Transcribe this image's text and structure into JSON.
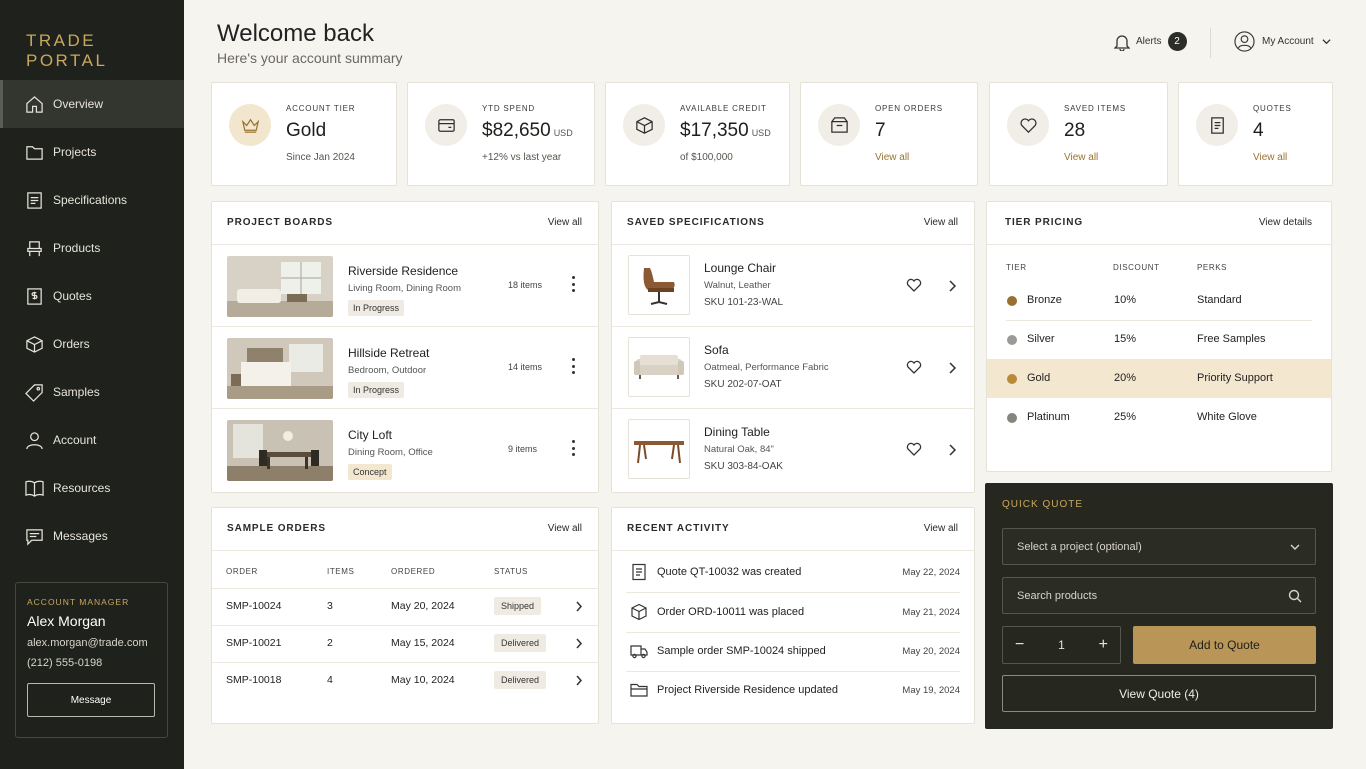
{
  "brand": "TRADE PORTAL",
  "nav": [
    {
      "label": "Overview",
      "icon": "home-icon",
      "active": true
    },
    {
      "label": "Projects",
      "icon": "folder-icon"
    },
    {
      "label": "Specifications",
      "icon": "document-icon"
    },
    {
      "label": "Products",
      "icon": "chair-icon"
    },
    {
      "label": "Quotes",
      "icon": "dollar-document-icon"
    },
    {
      "label": "Orders",
      "icon": "box-icon"
    },
    {
      "label": "Samples",
      "icon": "tag-icon"
    },
    {
      "label": "Account",
      "icon": "user-icon"
    },
    {
      "label": "Resources",
      "icon": "book-icon"
    },
    {
      "label": "Messages",
      "icon": "message-icon"
    }
  ],
  "manager": {
    "label": "ACCOUNT MANAGER",
    "name": "Alex Morgan",
    "email": "alex.morgan@trade.com",
    "phone": "(212) 555-0198",
    "button": "Message"
  },
  "header": {
    "title": "Welcome back",
    "subtitle": "Here's your account summary",
    "alerts_label": "Alerts",
    "alerts_count": "2",
    "account_label": "My Account"
  },
  "stats": [
    {
      "label": "ACCOUNT TIER",
      "value": "Gold",
      "unit": "",
      "sub": "Since Jan 2024",
      "icon": "crown-icon"
    },
    {
      "label": "YTD SPEND",
      "value": "$82,650",
      "unit": "USD",
      "sub": "+12% vs last year",
      "icon": "card-icon"
    },
    {
      "label": "AVAILABLE CREDIT",
      "value": "$17,350",
      "unit": "USD",
      "sub": "of $100,000",
      "icon": "box-icon"
    },
    {
      "label": "OPEN ORDERS",
      "value": "7",
      "unit": "",
      "sub": "View all",
      "icon": "box-icon"
    },
    {
      "label": "SAVED ITEMS",
      "value": "28",
      "unit": "",
      "sub": "View all",
      "icon": "heart-icon"
    },
    {
      "label": "QUOTES",
      "value": "4",
      "unit": "",
      "sub": "View all",
      "icon": "document-icon"
    }
  ],
  "boards": {
    "title": "PROJECT BOARDS",
    "link": "View all",
    "items": [
      {
        "name": "Riverside Residence",
        "rooms": "Living Room, Dining Room",
        "status": "In Progress",
        "count": "18 items"
      },
      {
        "name": "Hillside Retreat",
        "rooms": "Bedroom, Outdoor",
        "status": "In Progress",
        "count": "14 items"
      },
      {
        "name": "City Loft",
        "rooms": "Dining Room, Office",
        "status": "Concept",
        "count": "9 items"
      }
    ]
  },
  "specs": {
    "title": "SAVED SPECIFICATIONS",
    "link": "View all",
    "items": [
      {
        "name": "Lounge Chair",
        "material": "Walnut, Leather",
        "sku": "SKU 101-23-WAL"
      },
      {
        "name": "Sofa",
        "material": "Oatmeal, Performance Fabric",
        "sku": "SKU 202-07-OAT"
      },
      {
        "name": "Dining Table",
        "material": "Natural Oak, 84\"",
        "sku": "SKU 303-84-OAK"
      }
    ]
  },
  "tiers": {
    "title": "TIER PRICING",
    "link": "View details",
    "headers": [
      "TIER",
      "DISCOUNT",
      "PERKS"
    ],
    "rows": [
      {
        "name": "Bronze",
        "discount": "10%",
        "perks": "Standard",
        "color": "#9a6f32"
      },
      {
        "name": "Silver",
        "discount": "15%",
        "perks": "Free Samples",
        "color": "#9a9a96"
      },
      {
        "name": "Gold",
        "discount": "20%",
        "perks": "Priority Support",
        "color": "#b98a37"
      },
      {
        "name": "Platinum",
        "discount": "25%",
        "perks": "White Glove",
        "color": "#85847f"
      }
    ]
  },
  "orders": {
    "title": "SAMPLE ORDERS",
    "link": "View all",
    "headers": [
      "ORDER",
      "ITEMS",
      "ORDERED",
      "STATUS"
    ],
    "rows": [
      {
        "id": "SMP-10024",
        "items": "3",
        "date": "May 20, 2024",
        "status": "Shipped"
      },
      {
        "id": "SMP-10021",
        "items": "2",
        "date": "May 15, 2024",
        "status": "Delivered"
      },
      {
        "id": "SMP-10018",
        "items": "4",
        "date": "May 10, 2024",
        "status": "Delivered"
      }
    ]
  },
  "activity": {
    "title": "RECENT ACTIVITY",
    "link": "View all",
    "items": [
      {
        "text": "Quote QT-10032 was created",
        "date": "May 22, 2024",
        "icon": "document-icon"
      },
      {
        "text": "Order ORD-10011 was placed",
        "date": "May 21, 2024",
        "icon": "box-icon"
      },
      {
        "text": "Sample order SMP-10024 shipped",
        "date": "May 20, 2024",
        "icon": "truck-icon"
      },
      {
        "text": "Project Riverside Residence updated",
        "date": "May 19, 2024",
        "icon": "folder-icon"
      }
    ]
  },
  "quick_quote": {
    "title": "QUICK QUOTE",
    "project_placeholder": "Select a project (optional)",
    "search_placeholder": "Search products",
    "quantity": "1",
    "add_label": "Add to Quote",
    "view_label": "View Quote (4)"
  }
}
